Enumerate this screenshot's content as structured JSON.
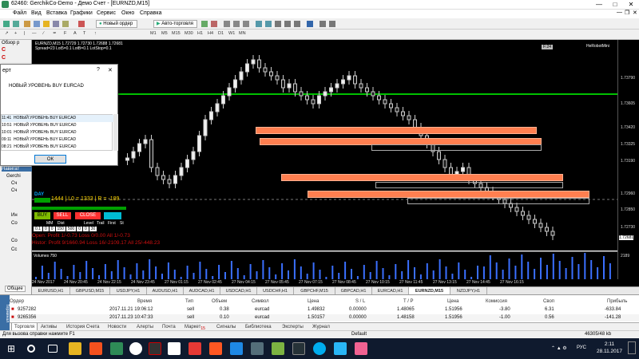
{
  "window": {
    "title": "62460: GerchikCo-Demo - Демо Счет - [EURNZD,M15]"
  },
  "menu": [
    "Файл",
    "Вид",
    "Вставка",
    "Графики",
    "Сервис",
    "Окно",
    "Справка"
  ],
  "toolbar": {
    "new_order": "Новый ордер",
    "auto_trading": "Авто-торговля",
    "timeframes": [
      "M1",
      "M5",
      "M15",
      "M30",
      "H1",
      "H4",
      "D1",
      "W1",
      "MN"
    ]
  },
  "left_panel": {
    "market_watch_title": "Обзор р",
    "navigator_title": "Навигат",
    "navigator_item": "Gerchi",
    "common_tab": "Общие",
    "tree_items": [
      "Сч",
      "Ин",
      "Со",
      "Со",
      "Сс"
    ]
  },
  "chart": {
    "symbol_line": "EURNZD,M15 1.72729 1.72730 1.72688 1.72681",
    "spread_line": "Spread=23 Lot5=0.1 LotB=0.1 LotStop=0.1",
    "corner_label": "F:24",
    "robot_label": "HeRobotMini",
    "day_label": "DAY",
    "info_line": "1444 | L0 = 1333 | R = -189",
    "buy_label": "BUY",
    "sell_label": "SELL",
    "close_label": "CLOSE",
    "headers": [
      "MM",
      "Dist",
      "Level",
      "Trail",
      "First",
      "St"
    ],
    "values": [
      "0.1",
      "0",
      "0",
      "150",
      "500",
      "0",
      "0",
      "30"
    ],
    "open_line": "Open: Profit 1/-0.73 Loss 0/0.00  All 1/-0.73",
    "history_line": "Histor: Profit 9/1660.94  Loss 16/-2109.17  All 25/-448.23",
    "volumes_label": "Volumes 750",
    "vol_top": "2189",
    "y_ticks": [
      "1.73790",
      "1.73605",
      "1.73420",
      "1.73325",
      "1.73190",
      "1.72960",
      "1.72850",
      "1.72730",
      "1.72681"
    ],
    "x_ticks": [
      "24 Nov 2017",
      "24 Nov 20:45",
      "24 Nov 22:15",
      "24 Nov 23:45",
      "27 Nov 01:15",
      "27 Nov 02:45",
      "27 Nov 04:15",
      "27 Nov 05:45",
      "27 Nov 07:15",
      "27 Nov 08:45",
      "27 Nov 10:15",
      "27 Nov 11:45",
      "27 Nov 13:15",
      "27 Nov 14:45",
      "27 Nov 16:15"
    ]
  },
  "alert": {
    "title": "ерт",
    "message": "НОВЫЙ УРОВЕНЬ BUY EURCAD",
    "rows": [
      {
        "time": "11:41",
        "text": "НОВЫЙ УРОВЕНЬ BUY EURCAD"
      },
      {
        "time": "10:51",
        "text": "НОВЫЙ УРОВЕНЬ BUY EURCAD"
      },
      {
        "time": "10:01",
        "text": "НОВЫЙ УРОВЕНЬ BUY EURCAD"
      },
      {
        "time": "09:11",
        "text": "НОВЫЙ УРОВЕНЬ BUY EURCAD"
      },
      {
        "time": "08:21",
        "text": "НОВЫЙ УРОВЕНЬ BUY EURCAD"
      }
    ],
    "ok": "ОК"
  },
  "symbol_tabs": [
    "EURUSD,H1",
    "GBPUSD,M15",
    "USDJPY,H1",
    "AUDUSD,H1",
    "AUDCAD,H1",
    "USDCAD,H1",
    "USDCHF,H1",
    "GBPCHF,M15",
    "GBPCAD,H1",
    "EURCAD,H1",
    "EURNZD,M15",
    "NZDJPY,H1"
  ],
  "terminal": {
    "headers": [
      "Ордер",
      "Время",
      "Тип",
      "Объем",
      "Символ",
      "Цена",
      "S / L",
      "T / P",
      "Цена",
      "Комиссия",
      "Своп",
      "Прибыль"
    ],
    "rows": [
      [
        "9257282",
        "2017.11.21 19:06:12",
        "sell",
        "0.38",
        "eurcad",
        "1.49832",
        "0.00000",
        "1.48065",
        "1.51956",
        "-3.80",
        "6.31",
        "-633.84"
      ],
      [
        "9265356",
        "2017.11.23 10:47:33",
        "sell",
        "0.10",
        "eurcad",
        "1.50157",
        "0.00000",
        "1.48158",
        "1.51956",
        "-1.00",
        "0.56",
        "-141.28"
      ]
    ],
    "tabs": [
      "Торговля",
      "Активы",
      "История Счета",
      "Новости",
      "Алерты",
      "Почта",
      "Маркет",
      "Сигналы",
      "Библиотека",
      "Эксперты",
      "Журнал"
    ],
    "market_badge": "15"
  },
  "status": {
    "help": "Для вызова справки нажмите F1",
    "profile": "Default",
    "traffic": "46305/48 kb"
  },
  "taskbar": {
    "time": "2:11",
    "date": "28.11.2017",
    "lang": "РУС"
  },
  "colors": {
    "zone": "#ff7f50",
    "level_line": "#00c000",
    "bull": "#f0f0f0",
    "bear": "#1a1a1a"
  }
}
